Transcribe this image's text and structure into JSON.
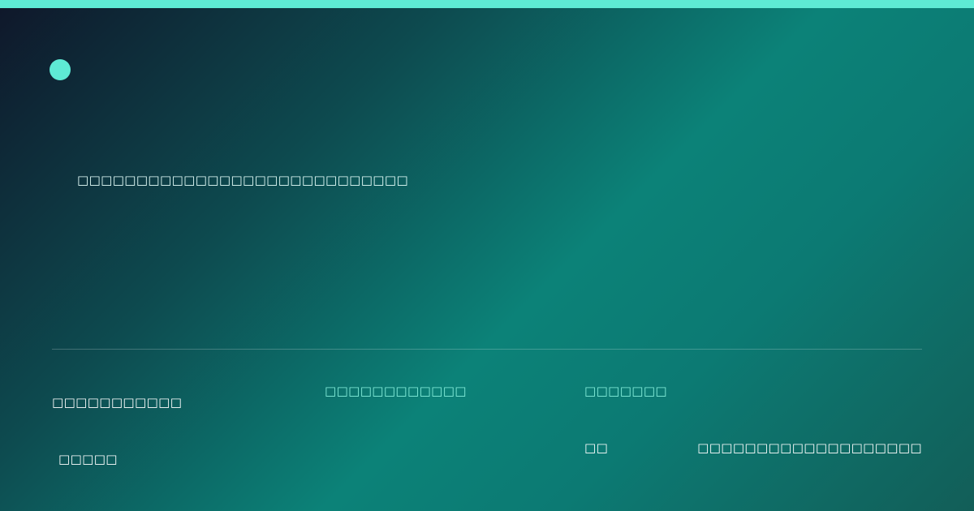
{
  "brand": {
    "accent_color": "#5eead4",
    "gradient_colors": [
      "#0f172a",
      "#0d4a4f",
      "#0c8278",
      "#125e58"
    ]
  },
  "hero": {
    "headline": "□□□□□□□□□□□□□□□□□□□□□□□□□□□□"
  },
  "footer": {
    "left_label": "□□□□□□□□□□□",
    "left_value": "□□□□□",
    "mid_label": "□□□□□□□□□□□□",
    "right_label": "□□□□□□□",
    "right_value": "□□",
    "far_right_value": "□□□□□□□□□□□□□□□□□□□"
  }
}
